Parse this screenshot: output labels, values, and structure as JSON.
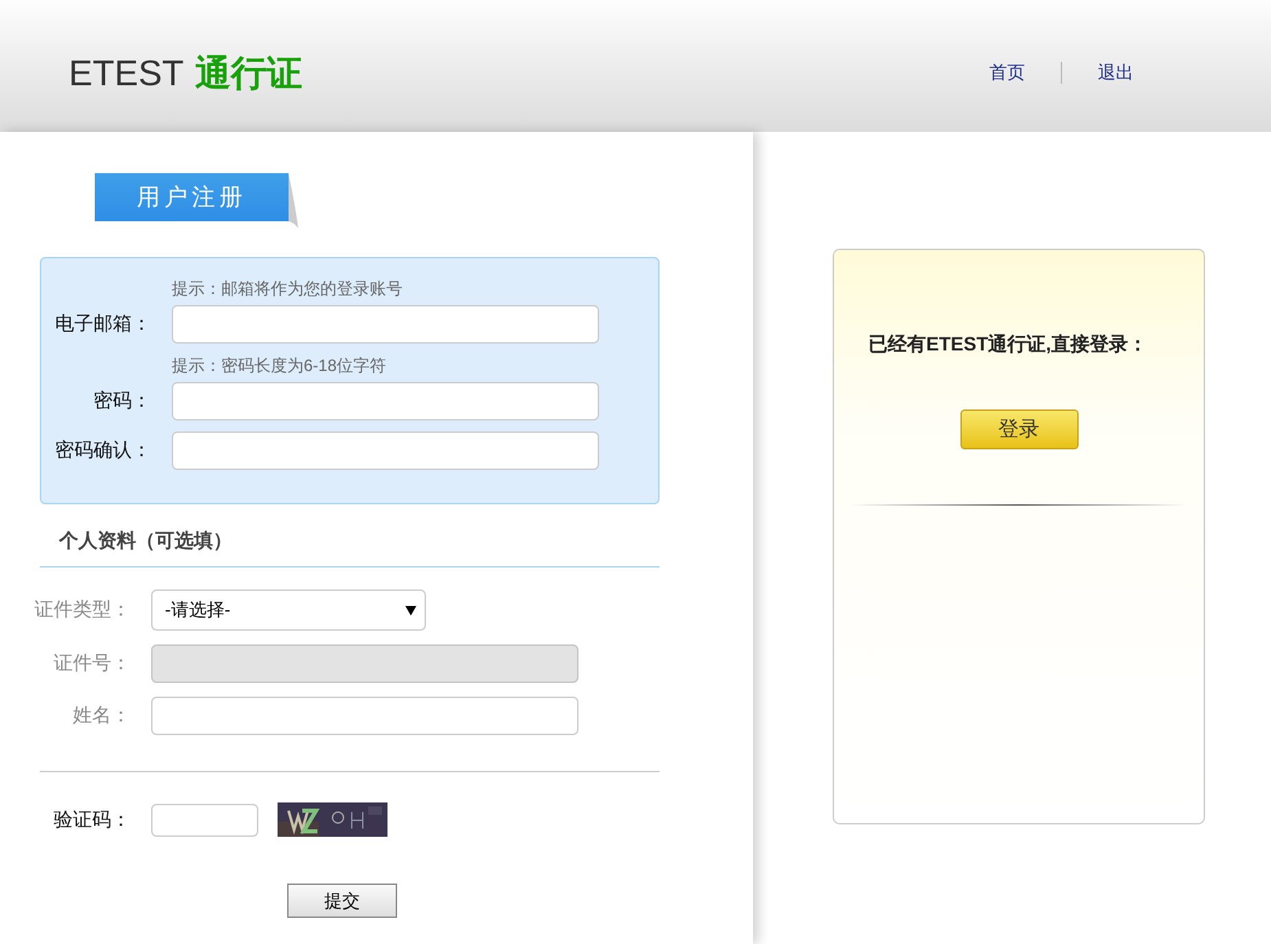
{
  "header": {
    "logo_text": "ETEST",
    "logo_accent": "通行证",
    "nav": [
      "首页",
      "退出"
    ]
  },
  "registration": {
    "tab_title": "用户注册",
    "required_fields": [
      {
        "label": "电子邮箱：",
        "hint": "提示：邮箱将作为您的登录账号"
      },
      {
        "label": "密码：",
        "hint": "提示：密码长度为6-18位字符"
      },
      {
        "label": "密码确认："
      }
    ],
    "optional_title": "个人资料（可选填）",
    "optional_fields": [
      {
        "kind": "select",
        "label": "证件类型：",
        "value": "-请选择-",
        "disabled": false
      },
      {
        "kind": "text",
        "label": "证件号：",
        "disabled": true
      },
      {
        "kind": "text",
        "label": "姓名：",
        "disabled": false
      }
    ],
    "captcha_label": "验证码：",
    "submit": "提交"
  },
  "login": {
    "message": "已经有ETEST通行证,直接登录：",
    "button": "登录"
  }
}
